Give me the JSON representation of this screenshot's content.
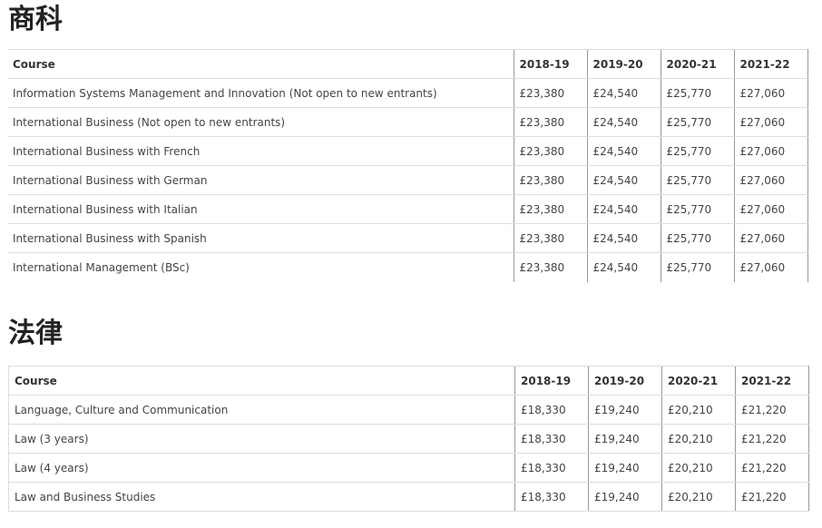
{
  "sections": [
    {
      "title": "商科",
      "headers": [
        "Course",
        "2018-19",
        "2019-20",
        "2020-21",
        "2021-22"
      ],
      "rows": [
        [
          "Information Systems Management and Innovation (Not open to new entrants)",
          "£23,380",
          "£24,540",
          "£25,770",
          "£27,060"
        ],
        [
          "International Business (Not open to new entrants)",
          "£23,380",
          "£24,540",
          "£25,770",
          "£27,060"
        ],
        [
          "International Business with French",
          "£23,380",
          "£24,540",
          "£25,770",
          "£27,060"
        ],
        [
          "International Business with German",
          "£23,380",
          "£24,540",
          "£25,770",
          "£27,060"
        ],
        [
          "International Business with Italian",
          "£23,380",
          "£24,540",
          "£25,770",
          "£27,060"
        ],
        [
          "International Business with Spanish",
          "£23,380",
          "£24,540",
          "£25,770",
          "£27,060"
        ],
        [
          "International Management (BSc)",
          "£23,380",
          "£24,540",
          "£25,770",
          "£27,060"
        ]
      ]
    },
    {
      "title": "法律",
      "headers": [
        "Course",
        "2018-19",
        "2019-20",
        "2020-21",
        "2021-22"
      ],
      "rows": [
        [
          "Language, Culture and Communication",
          "£18,330",
          "£19,240",
          "£20,210",
          "£21,220"
        ],
        [
          "Law (3 years)",
          "£18,330",
          "£19,240",
          "£20,210",
          "£21,220"
        ],
        [
          "Law (4 years)",
          "£18,330",
          "£19,240",
          "£20,210",
          "£21,220"
        ],
        [
          "Law and Business Studies",
          "£18,330",
          "£19,240",
          "£20,210",
          "£21,220"
        ]
      ]
    }
  ]
}
